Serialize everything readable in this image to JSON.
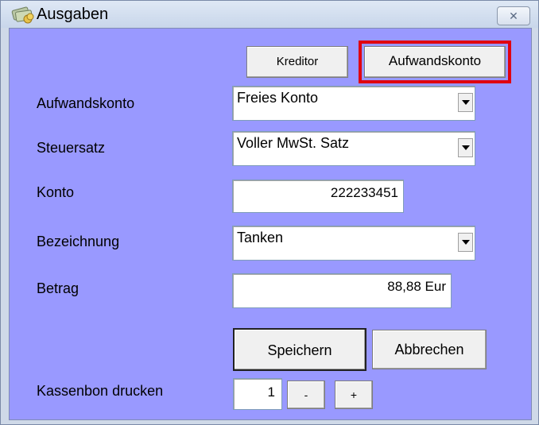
{
  "window": {
    "title": "Ausgaben",
    "close_icon": "close-icon",
    "app_icon": "money-icon"
  },
  "tabs": {
    "kreditor": "Kreditor",
    "aufwandskonto": "Aufwandskonto"
  },
  "form": {
    "aufwandskonto": {
      "label": "Aufwandskonto",
      "value": "Freies Konto"
    },
    "steuersatz": {
      "label": "Steuersatz",
      "value": "Voller MwSt. Satz"
    },
    "konto": {
      "label": "Konto",
      "value": "222233451"
    },
    "bezeichnung": {
      "label": "Bezeichnung",
      "value": "Tanken"
    },
    "betrag": {
      "label": "Betrag",
      "value": "88,88 Eur"
    }
  },
  "actions": {
    "save": "Speichern",
    "cancel": "Abbrechen"
  },
  "print": {
    "label": "Kassenbon drucken",
    "count": "1",
    "minus": "-",
    "plus": "+"
  },
  "colors": {
    "client_bg": "#9999ff",
    "highlight": "#e00010"
  }
}
